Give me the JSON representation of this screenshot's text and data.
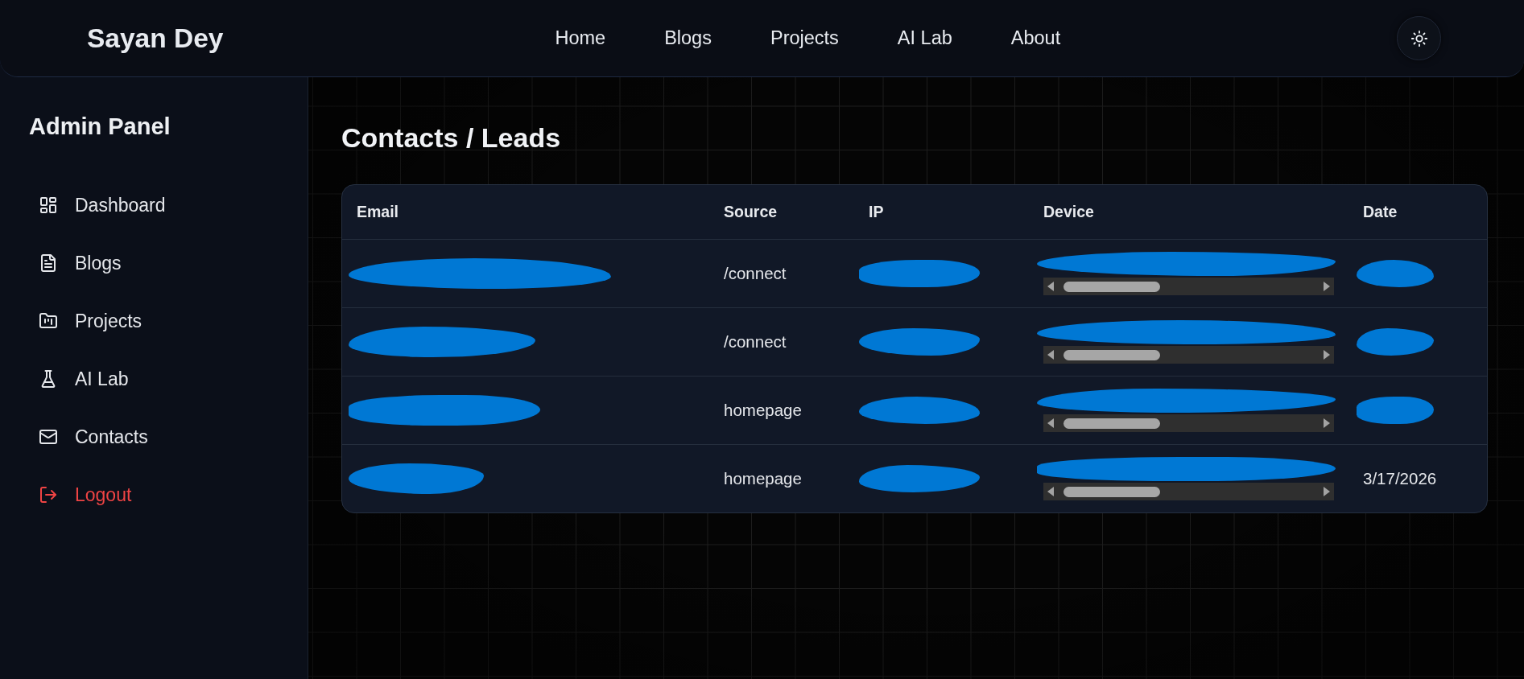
{
  "header": {
    "title": "Sayan Dey",
    "nav": [
      "Home",
      "Blogs",
      "Projects",
      "AI Lab",
      "About"
    ]
  },
  "sidebar": {
    "title": "Admin Panel",
    "items": [
      {
        "label": "Dashboard",
        "kind": "link"
      },
      {
        "label": "Blogs",
        "kind": "link"
      },
      {
        "label": "Projects",
        "kind": "link"
      },
      {
        "label": "AI Lab",
        "kind": "link"
      },
      {
        "label": "Contacts",
        "kind": "link"
      },
      {
        "label": "Logout",
        "kind": "logout"
      }
    ]
  },
  "page": {
    "heading": "Contacts / Leads"
  },
  "table": {
    "columns": [
      {
        "label": "Email",
        "kind": "text"
      },
      {
        "label": "Source",
        "kind": "text"
      },
      {
        "label": "IP",
        "kind": "text"
      },
      {
        "label": "Device",
        "kind": "scroll"
      },
      {
        "label": "Date",
        "kind": "text"
      }
    ],
    "rows": [
      {
        "cells": [
          {
            "redacted": true
          },
          {
            "text": "/connect",
            "redacted": false
          },
          {
            "redacted": true
          },
          {
            "redacted": true
          },
          {
            "redacted": true
          }
        ]
      },
      {
        "cells": [
          {
            "redacted": true
          },
          {
            "text": "/connect",
            "redacted": false
          },
          {
            "redacted": true
          },
          {
            "redacted": true
          },
          {
            "redacted": true
          }
        ]
      },
      {
        "cells": [
          {
            "redacted": true
          },
          {
            "text": "homepage",
            "redacted": false
          },
          {
            "redacted": true
          },
          {
            "redacted": true
          },
          {
            "redacted": true
          }
        ]
      },
      {
        "cells": [
          {
            "redacted": true
          },
          {
            "text": "homepage",
            "redacted": false
          },
          {
            "redacted": true
          },
          {
            "redacted": true
          },
          {
            "text": "3/17/2026",
            "redacted": false
          }
        ]
      }
    ]
  }
}
